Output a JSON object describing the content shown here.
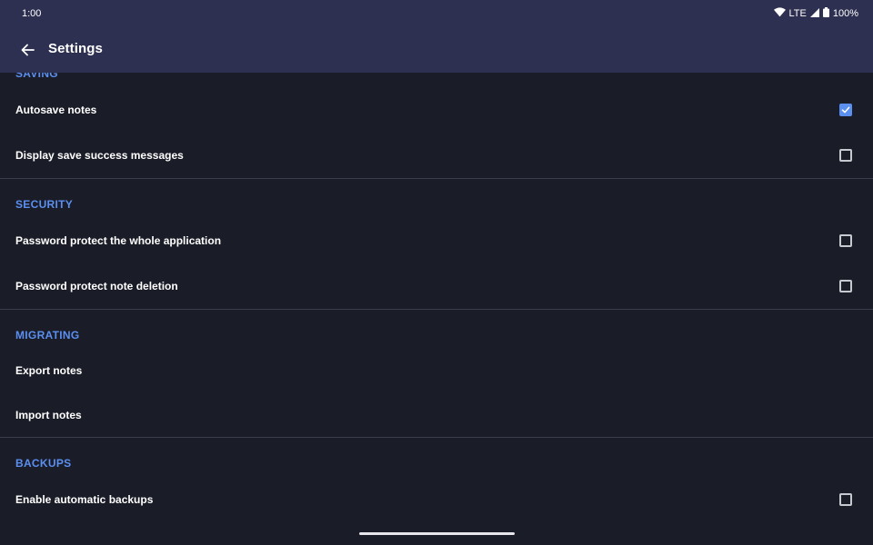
{
  "status_bar": {
    "time": "1:00",
    "network": "LTE",
    "battery": "100%",
    "icons": [
      "wifi-icon",
      "signal-icon",
      "battery-icon"
    ]
  },
  "app_bar": {
    "title": "Settings",
    "back_icon": "arrow-back-icon"
  },
  "colors": {
    "background": "#1a1c28",
    "app_bar": "#2d3050",
    "accent": "#5b8ff0",
    "divider": "#3a3d4e"
  },
  "sections": {
    "saving": {
      "header": "SAVING",
      "items": [
        {
          "label": "Autosave notes",
          "checked": true
        },
        {
          "label": "Display save success messages",
          "checked": false
        }
      ]
    },
    "security": {
      "header": "SECURITY",
      "items": [
        {
          "label": "Password protect the whole application",
          "checked": false
        },
        {
          "label": "Password protect note deletion",
          "checked": false
        }
      ]
    },
    "migrating": {
      "header": "MIGRATING",
      "items": [
        {
          "label": "Export notes"
        },
        {
          "label": "Import notes"
        }
      ]
    },
    "backups": {
      "header": "BACKUPS",
      "items": [
        {
          "label": "Enable automatic backups",
          "checked": false
        }
      ]
    }
  }
}
